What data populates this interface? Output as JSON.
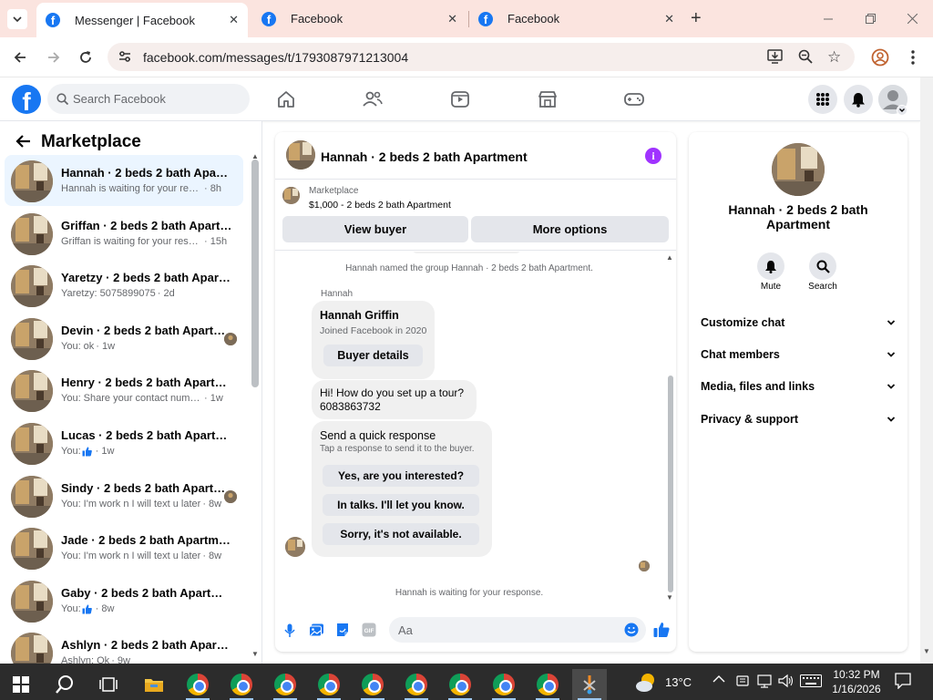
{
  "browser": {
    "tabs": [
      {
        "title": "Messenger | Facebook",
        "active": true
      },
      {
        "title": "Facebook",
        "active": false
      },
      {
        "title": "Facebook",
        "active": false
      }
    ],
    "url": "facebook.com/messages/t/1793087971213004"
  },
  "fb_header": {
    "logo": "f",
    "search_placeholder": "Search Facebook"
  },
  "sidebar": {
    "title": "Marketplace",
    "conversations": [
      {
        "title": "Hannah · 2 beds 2 bath Apartm...",
        "preview": "Hannah is waiting for your respon...",
        "time": "· 8h",
        "selected": true
      },
      {
        "title": "Griffan · 2 beds 2 bath Apartment",
        "preview": "Griffan is waiting for your respon...",
        "time": "· 15h"
      },
      {
        "title": "Yaretzy · 2 beds 2 bath Apartme...",
        "preview": "Yaretzy: 5075899075",
        "time": "· 2d"
      },
      {
        "title": "Devin · 2 beds 2 bath Apartm...",
        "preview": "You: ok",
        "time": "· 1w",
        "has_avatar": true
      },
      {
        "title": "Henry · 2 beds 2 bath Apartment",
        "preview": "You: Share your contact number a...",
        "time": "· 1w"
      },
      {
        "title": "Lucas · 2 beds 2 bath Apartment",
        "preview": "You: ",
        "time": "· 1w",
        "icon": "thumbs-up-icon"
      },
      {
        "title": "Sindy · 2 beds 2 bath Apartm...",
        "preview": "You: I'm work n I will text u later",
        "time": "· 8w",
        "has_avatar": true
      },
      {
        "title": "Jade · 2 beds 2 bath Apartment",
        "preview": "You: I'm work n I will text u later",
        "time": "· 8w"
      },
      {
        "title": "Gaby · 2 beds 2 bath Apartment",
        "preview": "You: ",
        "time": "· 8w",
        "icon": "thumbs-up-icon"
      },
      {
        "title": "Ashlyn · 2 beds 2 bath Apartment",
        "preview": "Ashlyn: Ok",
        "time": "· 9w"
      }
    ]
  },
  "chat": {
    "title": "Hannah · 2 beds 2 bath Apartment",
    "marketplace_label": "Marketplace",
    "listing": "$1,000 - 2 beds 2 bath Apartment",
    "view_buyer": "View buyer",
    "more_options": "More options",
    "system_message": "Hannah named the group Hannah · 2 beds 2 bath Apartment.",
    "sender_name": "Hannah",
    "buyer_card": {
      "name": "Hannah Griffin",
      "joined": "Joined Facebook in 2020",
      "button": "Buyer details"
    },
    "message": "Hi! How do you set up a tour?\n6083863732",
    "quick_response": {
      "title": "Send a quick response",
      "subtitle": "Tap a response to send it to the buyer.",
      "options": [
        "Yes, are you interested?",
        "In talks. I'll let you know.",
        "Sorry, it's not available."
      ]
    },
    "waiting_text": "Hannah is waiting for your response.",
    "input_placeholder": "Aa"
  },
  "details": {
    "name": "Hannah · 2 beds 2 bath Apartment",
    "actions": [
      {
        "label": "Mute",
        "icon": "bell-icon"
      },
      {
        "label": "Search",
        "icon": "search-icon"
      }
    ],
    "sections": [
      "Customize chat",
      "Chat members",
      "Media, files and links",
      "Privacy & support"
    ]
  },
  "taskbar": {
    "weather": "13°C",
    "time": "10:32 PM",
    "date": "1/16/2026"
  },
  "colors": {
    "fb_blue": "#1877f2",
    "accent_purple": "#a033ff",
    "selected_bg": "#ebf5ff"
  }
}
